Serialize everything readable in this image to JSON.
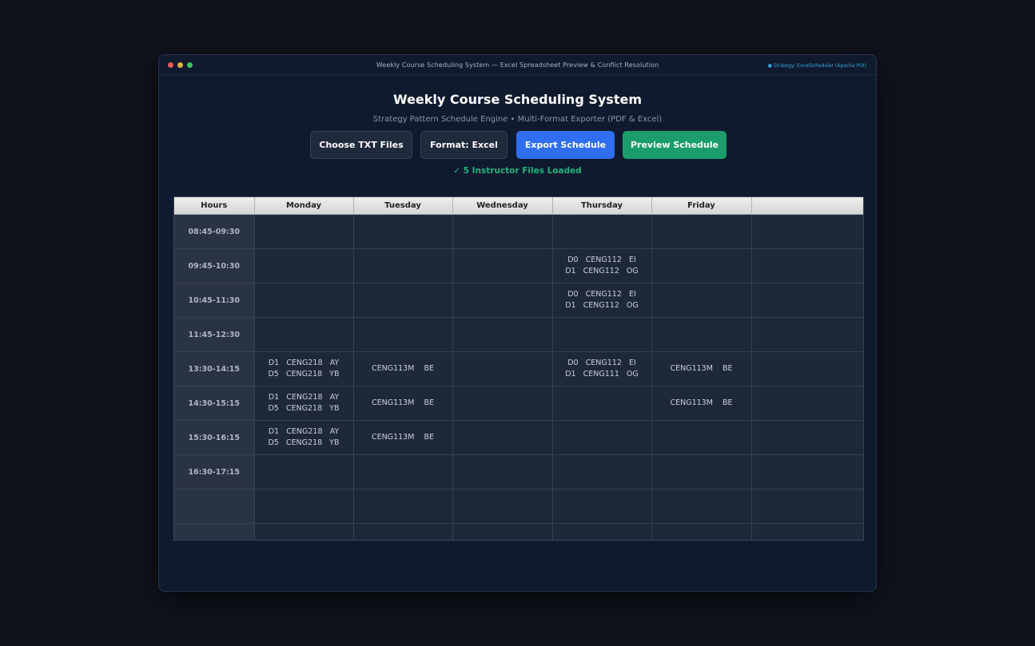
{
  "window": {
    "title": "Weekly Course Scheduling System — Excel Spreadsheet Preview & Conflict Resolution",
    "strategy_badge": "● Strategy: ExcelScheduler (Apache POI)"
  },
  "header": {
    "title": "Weekly Course Scheduling System",
    "subtitle": "Strategy Pattern Schedule Engine  •  Multi-Format Exporter (PDF & Excel)"
  },
  "toolbar": {
    "choose_label": "Choose TXT Files",
    "format_label": "Format: Excel",
    "export_label": "Export Schedule",
    "preview_label": "Preview Schedule"
  },
  "status": {
    "loaded": "✓ 5 Instructor Files Loaded"
  },
  "colors": {
    "accent_blue": "#2f6ef0",
    "accent_green": "#1a9d6a",
    "status_green": "#22b37a"
  },
  "table": {
    "headers": [
      "Hours",
      "Monday",
      "Tuesday",
      "Wednesday",
      "Thursday",
      "Friday",
      ""
    ],
    "rows": [
      {
        "hour": "08:45-09:30",
        "cells": [
          [],
          [],
          [],
          [],
          [],
          []
        ]
      },
      {
        "hour": "09:45-10:30",
        "cells": [
          [],
          [],
          [],
          [
            "D0   CENG112   EI",
            "D1   CENG112   OG"
          ],
          [],
          []
        ]
      },
      {
        "hour": "10:45-11:30",
        "cells": [
          [],
          [],
          [],
          [
            "D0   CENG112   EI",
            "D1   CENG112   OG"
          ],
          [],
          []
        ]
      },
      {
        "hour": "11:45-12:30",
        "cells": [
          [],
          [],
          [],
          [],
          [],
          []
        ]
      },
      {
        "hour": "13:30-14:15",
        "cells": [
          [
            "D1   CENG218   AY",
            "D5   CENG218   YB"
          ],
          [
            "CENG113M    BE"
          ],
          [],
          [
            "D0   CENG112   EI",
            "D1   CENG111   OG"
          ],
          [
            "CENG113M    BE"
          ],
          []
        ]
      },
      {
        "hour": "14:30-15:15",
        "cells": [
          [
            "D1   CENG218   AY",
            "D5   CENG218   YB"
          ],
          [
            "CENG113M    BE"
          ],
          [],
          [],
          [
            "CENG113M    BE"
          ],
          []
        ]
      },
      {
        "hour": "15:30-16:15",
        "cells": [
          [
            "D1   CENG218   AY",
            "D5   CENG218   YB"
          ],
          [
            "CENG113M    BE"
          ],
          [],
          [],
          [],
          []
        ]
      },
      {
        "hour": "16:30-17:15",
        "cells": [
          [],
          [],
          [],
          [],
          [],
          []
        ]
      },
      {
        "hour": "",
        "cells": [
          [],
          [],
          [],
          [],
          [],
          []
        ]
      },
      {
        "hour": "",
        "cells": [
          [],
          [],
          [],
          [],
          [],
          []
        ]
      }
    ]
  }
}
